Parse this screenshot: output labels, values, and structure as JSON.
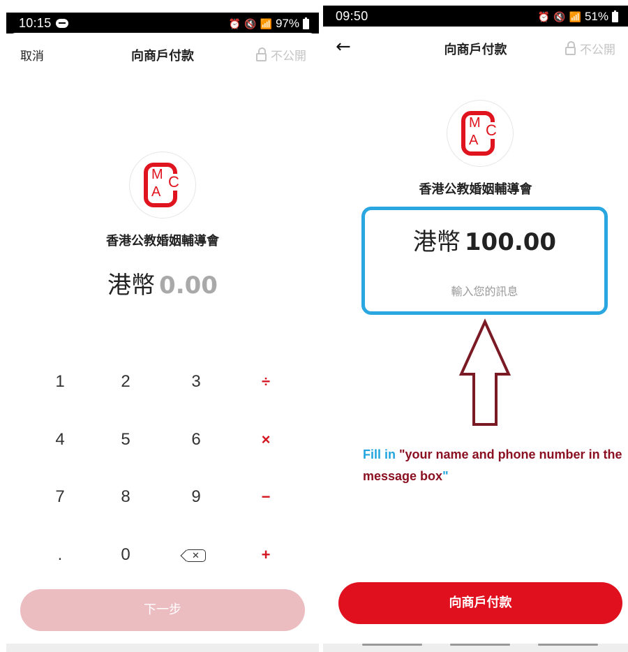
{
  "left_screen": {
    "status_bar": {
      "time": "10:15",
      "battery": "97%"
    },
    "nav": {
      "cancel": "取消",
      "title": "向商戶付款",
      "privacy": "不公開"
    },
    "merchant_name": "香港公教婚姻輔導會",
    "amount": {
      "currency": "港幣",
      "value": "0.00"
    },
    "keypad": {
      "digits": [
        "1",
        "2",
        "3",
        "4",
        "5",
        "6",
        "7",
        "8",
        "9",
        ".",
        "0"
      ],
      "operators": [
        "÷",
        "×",
        "−",
        "+"
      ],
      "backspace_icon": "backspace-icon"
    },
    "next_button": "下一步"
  },
  "right_screen": {
    "status_bar": {
      "time": "09:50",
      "battery": "51%"
    },
    "nav": {
      "back_icon": "arrow-left-icon",
      "title": "向商戶付款",
      "privacy": "不公開"
    },
    "merchant_name": "香港公教婚姻輔導會",
    "amount": {
      "currency": "港幣",
      "value": "100.00"
    },
    "message_placeholder": "輸入您的訊息",
    "annotation": {
      "part1": "Fill in ",
      "part2": "\"your name and phone number in the message box",
      "part3": "\""
    },
    "pay_button": "向商戶付款"
  },
  "colors": {
    "brand_red": "#e0101e",
    "disabled_button": "#ebbcc0",
    "highlight_box": "#2aa6e0",
    "arrow": "#7a1a24",
    "annotation_blue": "#22a5de",
    "annotation_red": "#8a1022"
  },
  "logo_letters": {
    "m": "M",
    "a": "A",
    "c": "C"
  }
}
